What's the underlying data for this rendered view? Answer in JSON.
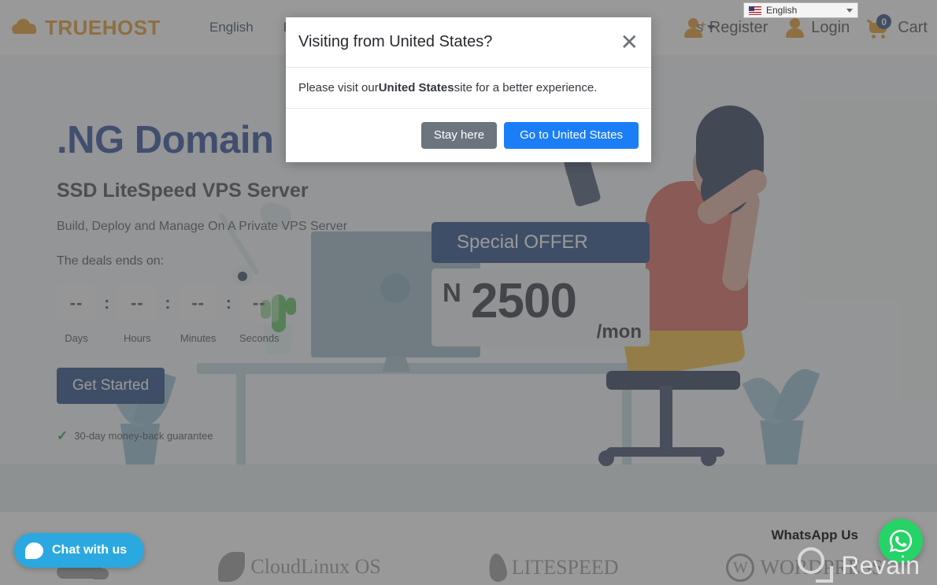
{
  "header": {
    "logo_text": "TRUEHOST",
    "nav": [
      {
        "label": "English",
        "has_caret": false
      },
      {
        "label": "Pricing",
        "has_caret": true
      },
      {
        "label": "s",
        "has_caret": true
      }
    ],
    "register_label": "Register",
    "login_label": "Login",
    "cart_label": "Cart",
    "cart_count": "0",
    "language_selected": "English"
  },
  "hero": {
    "title": ".NG Domain @ N",
    "subtitle": "SSD LiteSpeed VPS Server",
    "description": "Build, Deploy and Manage On A Private VPS Server",
    "deal_label": "The deals ends on:",
    "countdown": [
      {
        "value": "--",
        "label": "Days"
      },
      {
        "value": "--",
        "label": "Hours"
      },
      {
        "value": "--",
        "label": "Minutes"
      },
      {
        "value": "--",
        "label": "Seconds"
      }
    ],
    "separator": ":",
    "cta_label": "Get Started",
    "guarantee": "30-day money-back guarantee",
    "offer_badge": "Special OFFER",
    "price_currency": "N",
    "price_amount": "2500",
    "price_period": "/mon"
  },
  "partners": [
    {
      "name": "cloudflare",
      "text": ""
    },
    {
      "name": "cloudlinux",
      "text": "CloudLinux OS"
    },
    {
      "name": "litespeed",
      "text": "LITESPEED"
    },
    {
      "name": "wordpress",
      "text": "WORDPRESS",
      "mark": "W"
    }
  ],
  "widgets": {
    "chat_label": "Chat with us",
    "whatsapp_label": "WhatsApp Us",
    "revain_label": "Revain"
  },
  "modal": {
    "title": "Visiting from United States?",
    "body_prefix": "Please visit our ",
    "body_country": "United States",
    "body_suffix": " site for a better experience.",
    "close_icon": "✕",
    "stay_label": "Stay here",
    "go_label": "Go to United States"
  },
  "colors": {
    "brand_orange": "#e2921a",
    "navy": "#143a7b",
    "hero_blue": "#1b3a8f",
    "modal_blue": "#1b7ef7",
    "modal_gray": "#6c757d",
    "whatsapp_green": "#25d366",
    "chat_blue": "#2ba8e0",
    "check_green": "#169b3c"
  }
}
